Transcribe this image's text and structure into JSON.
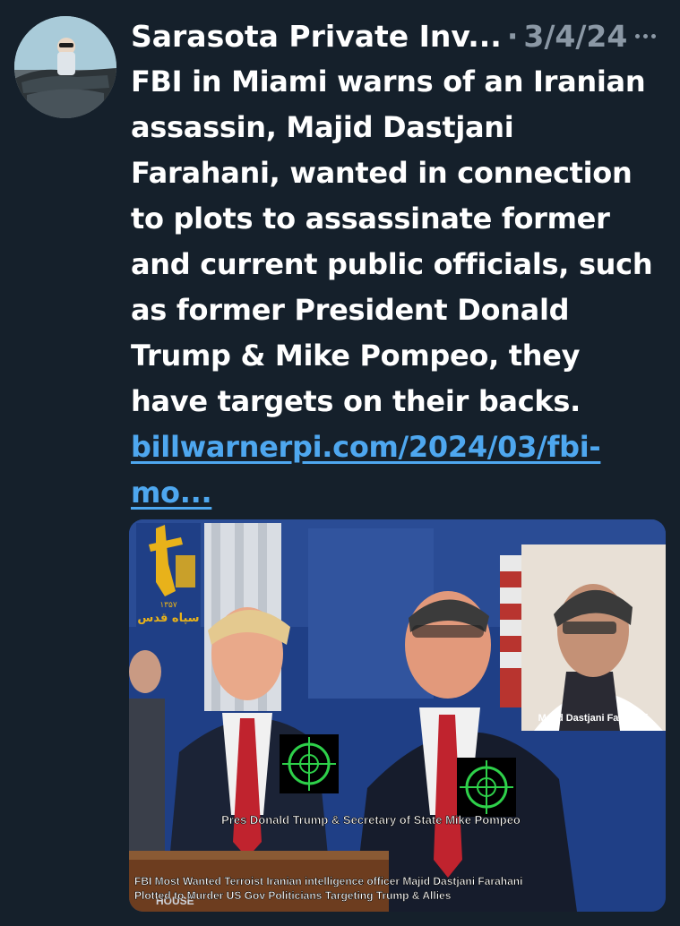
{
  "tweet": {
    "author_name": "Sarasota Private Inv...",
    "separator": "·",
    "date": "3/4/24",
    "body_lines": [
      "FBI in Miami warns of an Iranian",
      "assassin, Majid Dastjani",
      "Farahani, wanted in connection",
      "to plots to assassinate former",
      "and current public officials, such",
      "as former President Donald",
      "Trump & Mike Pompeo, they",
      "have targets on their backs."
    ],
    "link_lines": [
      "billwarnerpi.com/2024/03/fbi-",
      "mo..."
    ]
  },
  "media": {
    "logo_text_1": "سپاه قدس",
    "logo_text_2": "۱۳۵۷",
    "inset_caption": "Majid Dastjani Farahani",
    "mid_caption": "Pres Donald Trump & Secretary of State Mike Pompeo",
    "bottom_caption_1": "FBI Most Wanted Terroist Iranian intelligence officer Majid Dastjani Farahani",
    "bottom_caption_2": "Plotted to Murder US Gov Politicians Targeting Trump & Allies",
    "podium_text": "HOUSE"
  },
  "icons": {
    "more": "more-horizontal-icon",
    "crosshair": "crosshair-target-icon"
  },
  "colors": {
    "background": "#15202b",
    "text": "#ffffff",
    "secondary": "#8b98a5",
    "link": "#4ea7ef"
  }
}
